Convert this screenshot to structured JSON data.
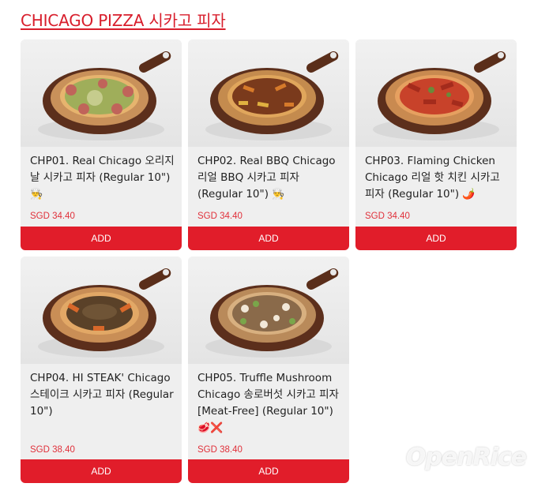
{
  "section": {
    "title": "CHICAGO PIZZA 시카고 피자"
  },
  "products": [
    {
      "name": "CHP01. Real Chicago 오리지날 시카고 피자 (Regular 10\")",
      "emoji": "👨‍🍳",
      "price": "SGD 34.40",
      "add_label": "ADD",
      "topping": "sausage-herb"
    },
    {
      "name": "CHP02. Real BBQ Chicago 리얼 BBQ 시카고 피자 (Regular 10\")",
      "emoji": "👨‍🍳",
      "price": "SGD 34.40",
      "add_label": "ADD",
      "topping": "bbq"
    },
    {
      "name": "CHP03. Flaming Chicken Chicago 리얼 핫 치킨 시카고 피자 (Regular 10\")",
      "emoji": "🌶️",
      "price": "SGD 34.40",
      "add_label": "ADD",
      "topping": "hot-chicken"
    },
    {
      "name": "CHP04. HI STEAK' Chicago 스테이크 시카고 피자 (Regular 10\")",
      "emoji": "",
      "price": "SGD 38.40",
      "add_label": "ADD",
      "topping": "steak"
    },
    {
      "name": "CHP05. Truffle Mushroom Chicago 송로버섯 시카고 피자 [Meat-Free] (Regular 10\")",
      "emoji": "🥩❌",
      "price": "SGD 38.40",
      "add_label": "ADD",
      "topping": "mushroom"
    }
  ],
  "colors": {
    "accent": "#e11d2a",
    "price": "#e0303a",
    "card_bg": "#efefef"
  },
  "watermark": "OpenRice"
}
